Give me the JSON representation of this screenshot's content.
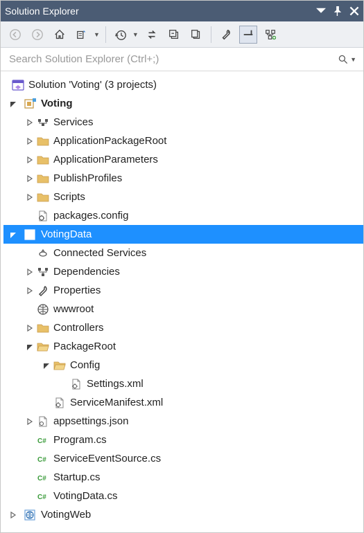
{
  "title": "Solution Explorer",
  "search_placeholder": "Search Solution Explorer (Ctrl+;)",
  "solution_label": "Solution 'Voting' (3 projects)",
  "projects": {
    "voting": {
      "label": "Voting",
      "children": {
        "services": "Services",
        "app_pkg_root": "ApplicationPackageRoot",
        "app_params": "ApplicationParameters",
        "publish_profiles": "PublishProfiles",
        "scripts": "Scripts",
        "packages_config": "packages.config"
      }
    },
    "votingdata": {
      "label": "VotingData",
      "children": {
        "connected_services": "Connected Services",
        "dependencies": "Dependencies",
        "properties": "Properties",
        "wwwroot": "wwwroot",
        "controllers": "Controllers",
        "package_root": {
          "label": "PackageRoot",
          "config": {
            "label": "Config",
            "settings_xml": "Settings.xml"
          },
          "service_manifest": "ServiceManifest.xml"
        },
        "appsettings": "appsettings.json",
        "program_cs": "Program.cs",
        "service_event_source_cs": "ServiceEventSource.cs",
        "startup_cs": "Startup.cs",
        "votingdata_cs": "VotingData.cs"
      }
    },
    "votingweb": {
      "label": "VotingWeb"
    }
  }
}
